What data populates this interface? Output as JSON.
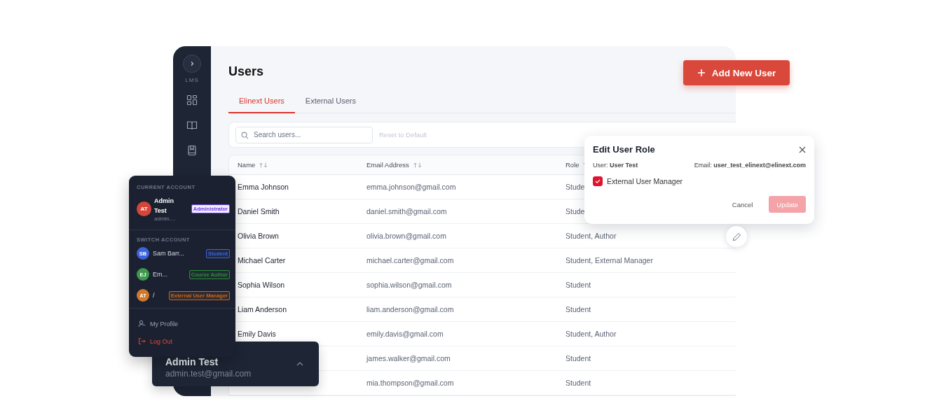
{
  "sidebar": {
    "brand": "LMS"
  },
  "page_title": "Users",
  "add_button": {
    "label": "Add New User"
  },
  "tabs": [
    {
      "label": "Elinext Users",
      "selected": true
    },
    {
      "label": "External Users",
      "selected": false
    }
  ],
  "search": {
    "placeholder": "Search users...",
    "reset": "Reset to Default"
  },
  "table": {
    "columns": [
      {
        "label": "Name",
        "kind": "sort"
      },
      {
        "label": "Email Address",
        "kind": "sort"
      },
      {
        "label": "Role",
        "kind": "filter"
      }
    ],
    "rows": [
      {
        "name": "Emma Johnson",
        "email": "emma.johnson@gmail.com",
        "role": "Stude"
      },
      {
        "name": "Daniel Smith",
        "email": "daniel.smith@gmail.com",
        "role": "Stude"
      },
      {
        "name": "Olivia Brown",
        "email": "olivia.brown@gmail.com",
        "role": "Student, Author"
      },
      {
        "name": "Michael Carter",
        "email": "michael.carter@gmail.com",
        "role": "Student, External Manager"
      },
      {
        "name": "Sophia Wilson",
        "email": "sophia.wilson@gmail.com",
        "role": "Student"
      },
      {
        "name": "Liam Anderson",
        "email": "liam.anderson@gmail.com",
        "role": "Student"
      },
      {
        "name": "Emily Davis",
        "email": "emily.davis@gmail.com",
        "role": "Student, Author"
      },
      {
        "email": "james.walker@gmail.com",
        "role": "Student"
      },
      {
        "email": "mia.thompson@gmail.com",
        "role": "Student"
      }
    ]
  },
  "edit_role_dialog": {
    "title": "Edit User Role",
    "user": "User: **User Test**",
    "email": "Email: **user_test_elinext@elinext.com**",
    "role": {
      "label": "External User Manager",
      "checked": true
    },
    "buttons": [
      {
        "label": "Cancel",
        "kind": "text",
        "disabled": false
      },
      {
        "label": "Update",
        "kind": "primary",
        "disabled": true
      }
    ]
  },
  "account_menu": {
    "current_heading": "CURRENT ACCOUNT",
    "current": {
      "initials": "AT",
      "name": "Admin Test",
      "email": "admin....",
      "color": "#d4463a",
      "role": {
        "label": "Administrator",
        "color": "#6d3fe0"
      }
    },
    "switch_heading": "SWITCH ACCOUNT",
    "accounts": [
      {
        "initials": "SB",
        "name": "Sam Barr...",
        "color": "#3c63dc",
        "role": {
          "label": "Student",
          "color": "#3c63dc"
        }
      },
      {
        "initials": "EJ",
        "name": "Em...",
        "color": "#3d9a4c",
        "role": {
          "label": "Course Author",
          "color": "#2f8a3e"
        }
      },
      {
        "initials": "AT",
        "name": "/",
        "color": "#d2782c",
        "role": {
          "label": "External User Manager",
          "color": "#c9661a"
        }
      }
    ],
    "actions": [
      {
        "label": "My Profile",
        "kind": "profile"
      },
      {
        "label": "Log Out",
        "kind": "logout"
      }
    ]
  },
  "user_card": {
    "name": "Admin Test",
    "email": "admin.test@gmail.com"
  }
}
